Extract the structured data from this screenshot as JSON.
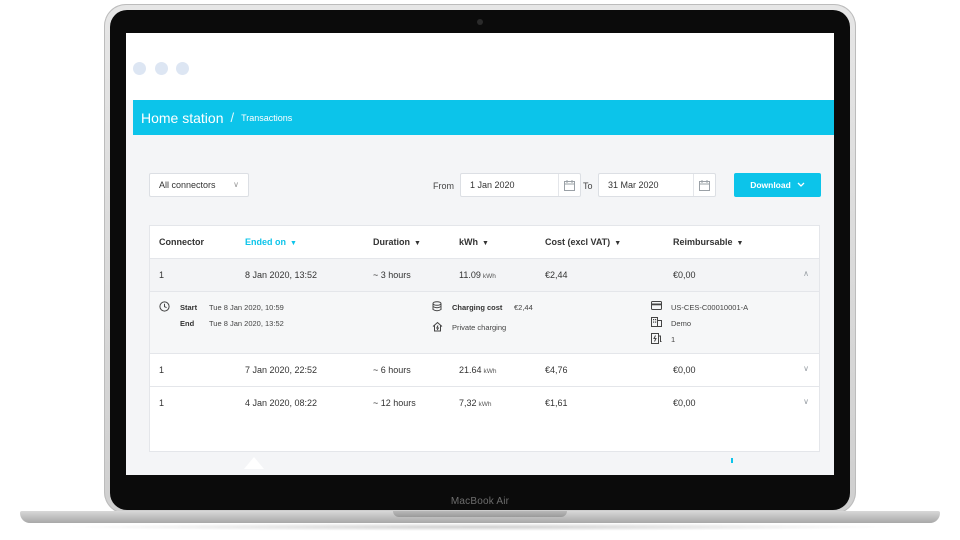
{
  "device": {
    "brand": "MacBook Air"
  },
  "header": {
    "title": "Home station",
    "separator": "/",
    "subtitle": "Transactions"
  },
  "filters": {
    "connector_select": "All connectors",
    "from_label": "From",
    "from_value": "1 Jan 2020",
    "to_label": "To",
    "to_value": "31 Mar 2020",
    "download_label": "Download"
  },
  "table": {
    "columns": [
      "Connector",
      "Ended on",
      "Duration",
      "kWh",
      "Cost (excl VAT)",
      "Reimbursable"
    ],
    "rows": [
      {
        "connector": "1",
        "ended_on": "8 Jan 2020, 13:52",
        "duration": "~ 3 hours",
        "kwh": "11.09",
        "kwh_unit": "kWh",
        "cost": "€2,44",
        "reimbursable": "€0,00"
      },
      {
        "connector": "1",
        "ended_on": "7 Jan 2020, 22:52",
        "duration": "~ 6 hours",
        "kwh": "21.64",
        "kwh_unit": "kWh",
        "cost": "€4,76",
        "reimbursable": "€0,00"
      },
      {
        "connector": "1",
        "ended_on": "4 Jan 2020, 08:22",
        "duration": "~ 12 hours",
        "kwh": "7,32",
        "kwh_unit": "kWh",
        "cost": "€1,61",
        "reimbursable": "€0,00"
      }
    ]
  },
  "detail": {
    "start_label": "Start",
    "start_value": "Tue 8 Jan 2020, 10:59",
    "end_label": "End",
    "end_value": "Tue 8 Jan 2020, 13:52",
    "charging_cost_label": "Charging cost",
    "charging_cost_value": "€2,44",
    "charging_type": "Private charging",
    "card_id": "US-CES-C00010001-A",
    "organization": "Demo",
    "charger_number": "1"
  },
  "colors": {
    "accent": "#0cc4ea",
    "background": "#f4f5f7"
  }
}
